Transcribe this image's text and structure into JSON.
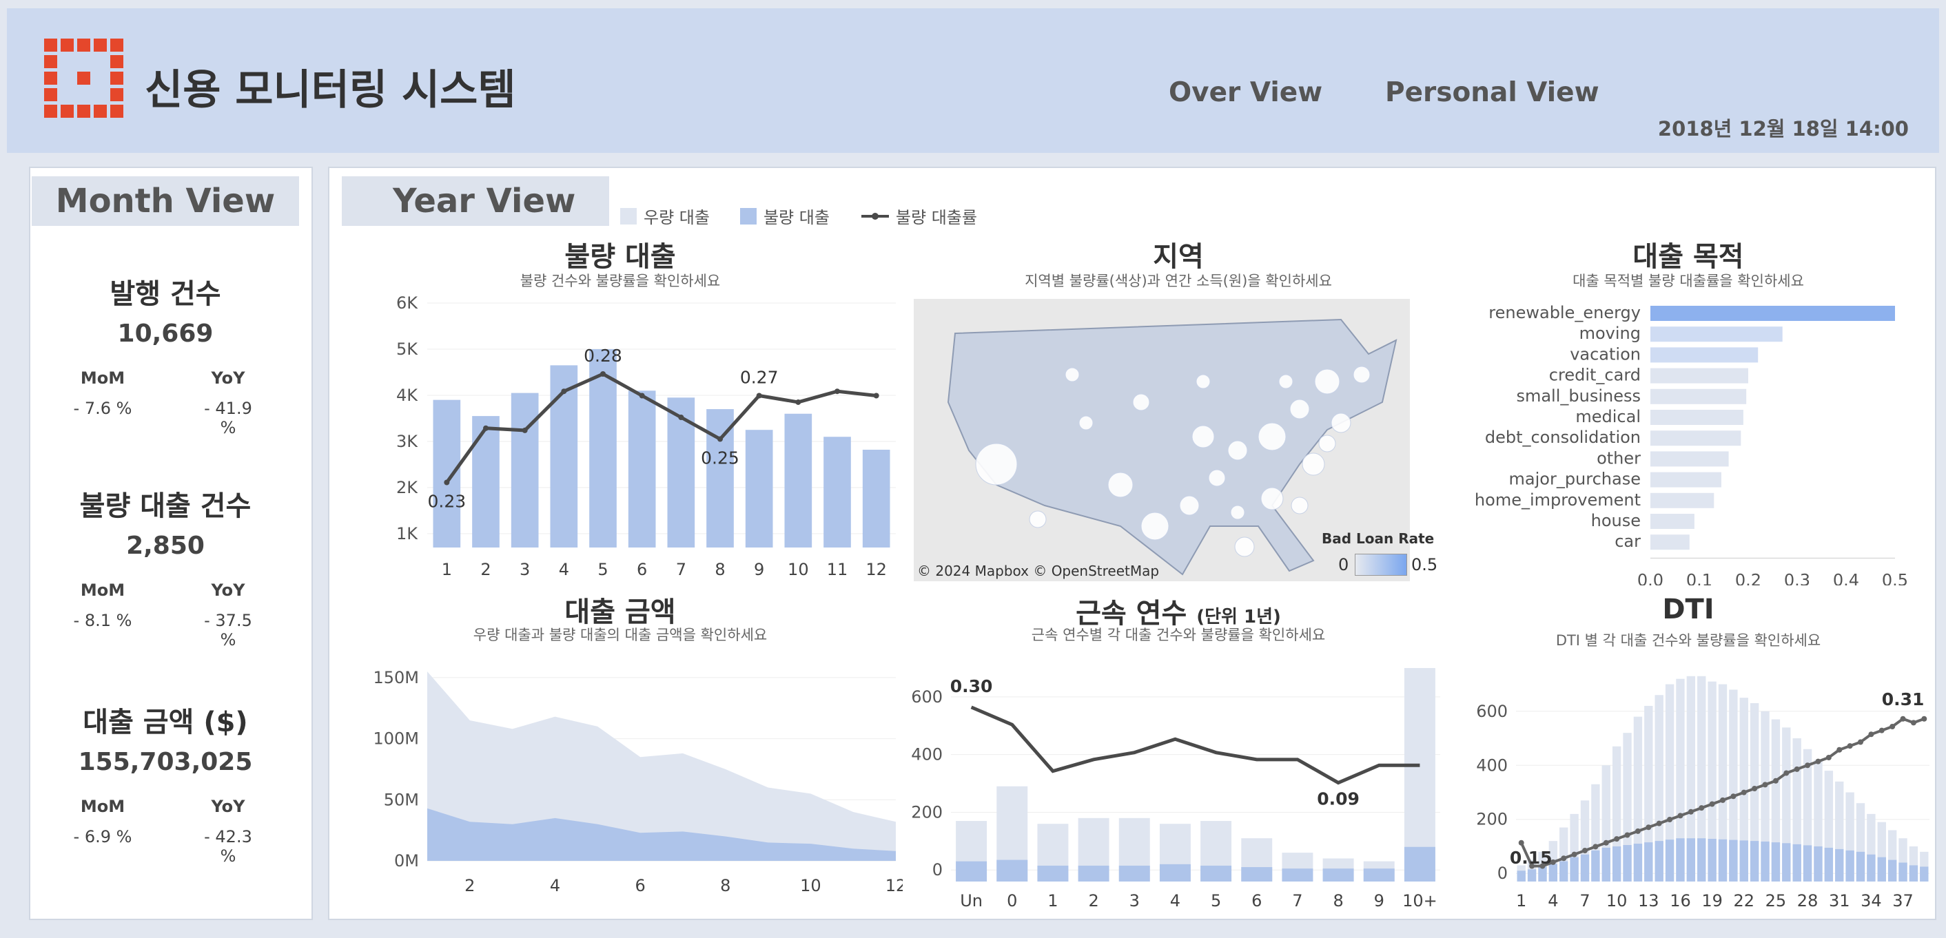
{
  "header": {
    "title": "신용 모니터링 시스템",
    "nav": [
      "Over View",
      "Personal View"
    ],
    "datetime": "2018년 12월 18일 14:00"
  },
  "month": {
    "tab": "Month View",
    "kpis": [
      {
        "title": "발행 건수",
        "value": "10,669",
        "mom_label": "MoM",
        "yoy_label": "YoY",
        "mom": "- 7.6 %",
        "yoy": "- 41.9 %"
      },
      {
        "title": "불량 대출 건수",
        "value": "2,850",
        "mom_label": "MoM",
        "yoy_label": "YoY",
        "mom": "- 8.1 %",
        "yoy": "- 37.5 %"
      },
      {
        "title": "대출 금액 ($)",
        "value": "155,703,025",
        "mom_label": "MoM",
        "yoy_label": "YoY",
        "mom": "- 6.9 %",
        "yoy": "- 42.3 %"
      }
    ]
  },
  "year": {
    "tab": "Year View",
    "legend": [
      "우량 대출",
      "불량 대출",
      "불량 대출률"
    ],
    "colors": {
      "good": "#dfe5f0",
      "bad": "#aec4ea",
      "line": "#4a4a4a",
      "accent": "#8db1ee"
    },
    "charts": {
      "bad_loan": {
        "title": "불량 대출",
        "subtitle": "불량 건수와 불량률을 확인하세요"
      },
      "region": {
        "title": "지역",
        "subtitle": "지역별 불량률(색상)과 연간 소득(원)을 확인하세요",
        "attribution": "© 2024 Mapbox © OpenStreetMap",
        "legend_title": "Bad Loan Rate",
        "legend_min": "0",
        "legend_max": "0.5"
      },
      "purpose": {
        "title": "대출 목적",
        "subtitle": "대출 목적별 불량 대출률을 확인하세요"
      },
      "amount": {
        "title": "대출 금액",
        "subtitle": "우량 대출과 불량 대출의 대출 금액을 확인하세요"
      },
      "tenure": {
        "title": "근속 연수",
        "title_suffix": "(단위 1년)",
        "subtitle": "근속 연수별 각 대출 건수와 불량률을 확인하세요"
      },
      "dti": {
        "title": "DTI",
        "subtitle": "DTI 별 각 대출 건수와 불량률을 확인하세요"
      }
    }
  },
  "chart_data": [
    {
      "type": "bar",
      "title": "불량 대출",
      "categories": [
        "1",
        "2",
        "3",
        "4",
        "5",
        "6",
        "7",
        "8",
        "9",
        "10",
        "11",
        "12"
      ],
      "y_ticks": [
        "1K",
        "2K",
        "3K",
        "4K",
        "5K",
        "6K"
      ],
      "ylim": [
        700,
        6000
      ],
      "series": [
        {
          "kind": "bar",
          "values": [
            3900,
            3550,
            4050,
            4650,
            5000,
            4100,
            3950,
            3700,
            3250,
            3600,
            3100,
            2820
          ]
        },
        {
          "kind": "line",
          "axis": "secondary",
          "values": [
            0.23,
            0.255,
            0.254,
            0.272,
            0.28,
            0.27,
            0.26,
            0.25,
            0.27,
            0.267,
            0.272,
            0.27
          ]
        }
      ],
      "line_ylim": [
        0.2,
        0.3
      ],
      "annotations": [
        {
          "i": 0,
          "text": "0.23"
        },
        {
          "i": 4,
          "text": "0.28"
        },
        {
          "i": 7,
          "text": "0.25"
        },
        {
          "i": 8,
          "text": "0.27"
        }
      ]
    },
    {
      "type": "bar",
      "title": "대출 목적",
      "orientation": "horizontal",
      "categories": [
        "renewable_energy",
        "moving",
        "vacation",
        "credit_card",
        "small_business",
        "medical",
        "debt_consolidation",
        "other",
        "major_purchase",
        "home_improvement",
        "house",
        "car"
      ],
      "values": [
        0.5,
        0.27,
        0.22,
        0.2,
        0.196,
        0.19,
        0.185,
        0.16,
        0.145,
        0.13,
        0.09,
        0.08
      ],
      "x_ticks": [
        "0.0",
        "0.1",
        "0.2",
        "0.3",
        "0.4",
        "0.5"
      ],
      "xlim": [
        0,
        0.5
      ]
    },
    {
      "type": "area",
      "title": "대출 금액",
      "x": [
        1,
        2,
        3,
        4,
        5,
        6,
        7,
        8,
        9,
        10,
        11,
        12
      ],
      "x_ticks": [
        "2",
        "4",
        "6",
        "8",
        "10",
        "12"
      ],
      "y_ticks": [
        "0M",
        "50M",
        "100M",
        "150M"
      ],
      "ylim": [
        0,
        155
      ],
      "series": [
        {
          "name": "우량 대출",
          "values": [
            155,
            115,
            108,
            118,
            110,
            85,
            88,
            75,
            60,
            55,
            40,
            32
          ]
        },
        {
          "name": "불량 대출",
          "values": [
            43,
            32,
            30,
            35,
            30,
            23,
            24,
            20,
            15,
            14,
            10,
            8
          ]
        }
      ]
    },
    {
      "type": "bar",
      "title": "근속 연수",
      "categories": [
        "Un",
        "0",
        "1",
        "2",
        "3",
        "4",
        "5",
        "6",
        "7",
        "8",
        "9",
        "10+"
      ],
      "y_ticks": [
        "0",
        "200",
        "400",
        "600"
      ],
      "ylim": [
        -40,
        700
      ],
      "series": [
        {
          "name": "우량 대출",
          "values": [
            170,
            290,
            160,
            180,
            180,
            160,
            170,
            110,
            60,
            40,
            30,
            720
          ]
        },
        {
          "name": "불량 대출",
          "values": [
            30,
            35,
            15,
            15,
            15,
            20,
            15,
            10,
            5,
            5,
            5,
            80
          ]
        },
        {
          "name": "불량 대출률",
          "values": [
            0.3,
            0.27,
            0.19,
            0.21,
            0.222,
            0.245,
            0.222,
            0.21,
            0.21,
            0.17,
            0.2,
            0.2
          ]
        }
      ],
      "line_ylim": [
        0.0,
        0.32
      ],
      "annotations": [
        {
          "i": 0,
          "text": "0.30"
        },
        {
          "i": 9,
          "text": "0.09"
        }
      ]
    },
    {
      "type": "bar",
      "title": "DTI",
      "x_ticks": [
        "1",
        "4",
        "7",
        "10",
        "13",
        "16",
        "19",
        "22",
        "25",
        "28",
        "31",
        "34",
        "37"
      ],
      "y_ticks": [
        "0",
        "200",
        "400",
        "600"
      ],
      "ylim": [
        -30,
        760
      ],
      "series": [
        {
          "name": "우량 대출",
          "values": [
            30,
            50,
            80,
            120,
            170,
            220,
            270,
            330,
            400,
            470,
            520,
            580,
            620,
            660,
            700,
            720,
            730,
            730,
            710,
            700,
            680,
            650,
            630,
            600,
            570,
            540,
            500,
            460,
            420,
            380,
            340,
            300,
            260,
            220,
            190,
            160,
            130,
            100,
            80
          ]
        },
        {
          "name": "불량 대출",
          "values": [
            10,
            15,
            25,
            35,
            45,
            60,
            70,
            85,
            95,
            100,
            105,
            110,
            115,
            120,
            125,
            130,
            130,
            130,
            128,
            126,
            124,
            122,
            120,
            118,
            115,
            112,
            108,
            104,
            100,
            95,
            90,
            85,
            80,
            70,
            60,
            50,
            40,
            30,
            25
          ]
        },
        {
          "name": "불량 대출률",
          "values": [
            0.15,
            0.12,
            0.12,
            0.125,
            0.13,
            0.135,
            0.14,
            0.145,
            0.15,
            0.155,
            0.16,
            0.165,
            0.17,
            0.175,
            0.18,
            0.185,
            0.19,
            0.195,
            0.2,
            0.205,
            0.21,
            0.215,
            0.22,
            0.225,
            0.23,
            0.24,
            0.245,
            0.25,
            0.255,
            0.26,
            0.27,
            0.275,
            0.28,
            0.29,
            0.295,
            0.3,
            0.31,
            0.305,
            0.31
          ]
        }
      ],
      "line_ylim": [
        0.1,
        0.34
      ],
      "annotations": [
        {
          "i": 0,
          "text": "0.15"
        },
        {
          "i": 36,
          "text": "0.31"
        }
      ]
    }
  ]
}
